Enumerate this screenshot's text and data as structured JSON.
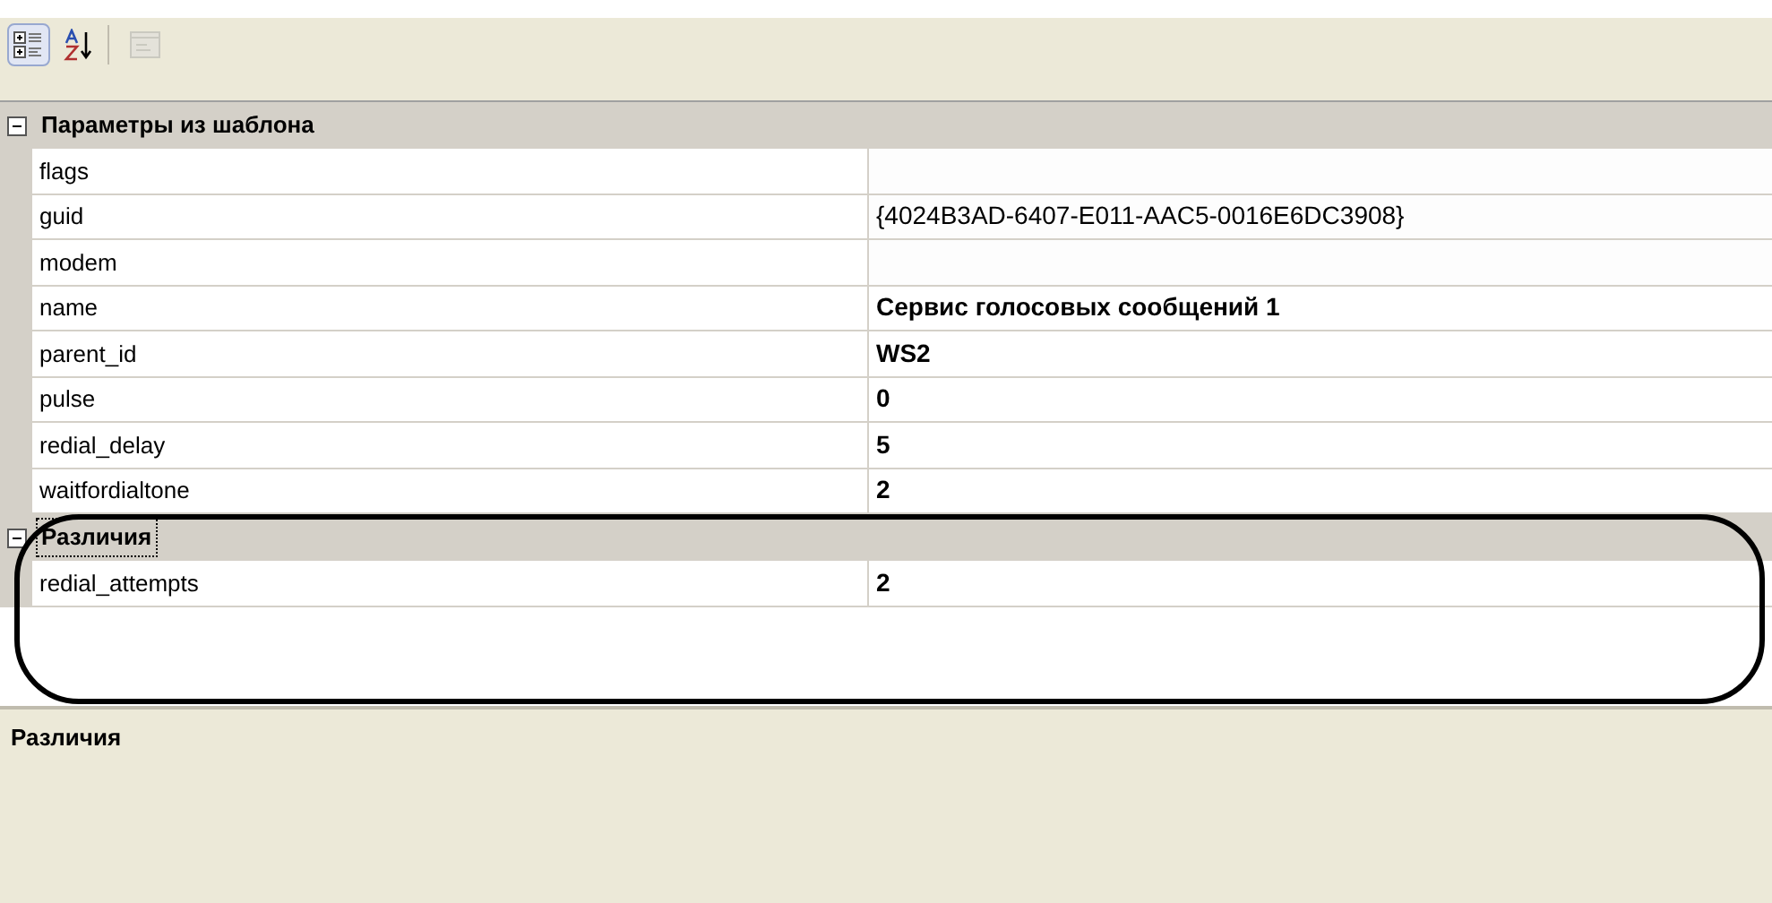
{
  "toolbar": [
    {
      "kind": "categorized",
      "selected": true,
      "disabled": false
    },
    {
      "kind": "alphabetical",
      "selected": false,
      "disabled": false
    },
    {
      "kind": "property-pages",
      "selected": false,
      "disabled": true
    }
  ],
  "sections": [
    {
      "title": "Параметры из шаблона",
      "expanded": true,
      "selected": false,
      "rows": [
        {
          "name": "flags",
          "value": "",
          "non_default": false
        },
        {
          "name": "guid",
          "value": "{4024B3AD-6407-E011-AAC5-0016E6DC3908}",
          "non_default": false
        },
        {
          "name": "modem",
          "value": "",
          "non_default": false
        },
        {
          "name": "name",
          "value": "Сервис голосовых сообщений 1",
          "non_default": true
        },
        {
          "name": "parent_id",
          "value": "WS2",
          "non_default": true
        },
        {
          "name": "pulse",
          "value": "0",
          "non_default": true
        },
        {
          "name": "redial_delay",
          "value": "5",
          "non_default": true
        },
        {
          "name": "waitfordialtone",
          "value": "2",
          "non_default": true
        }
      ]
    },
    {
      "title": "Различия",
      "expanded": true,
      "selected": true,
      "rows": [
        {
          "name": "redial_attempts",
          "value": "2",
          "non_default": true
        }
      ]
    }
  ],
  "description": {
    "title": "Различия"
  },
  "annotation": {
    "kind": "oval"
  }
}
